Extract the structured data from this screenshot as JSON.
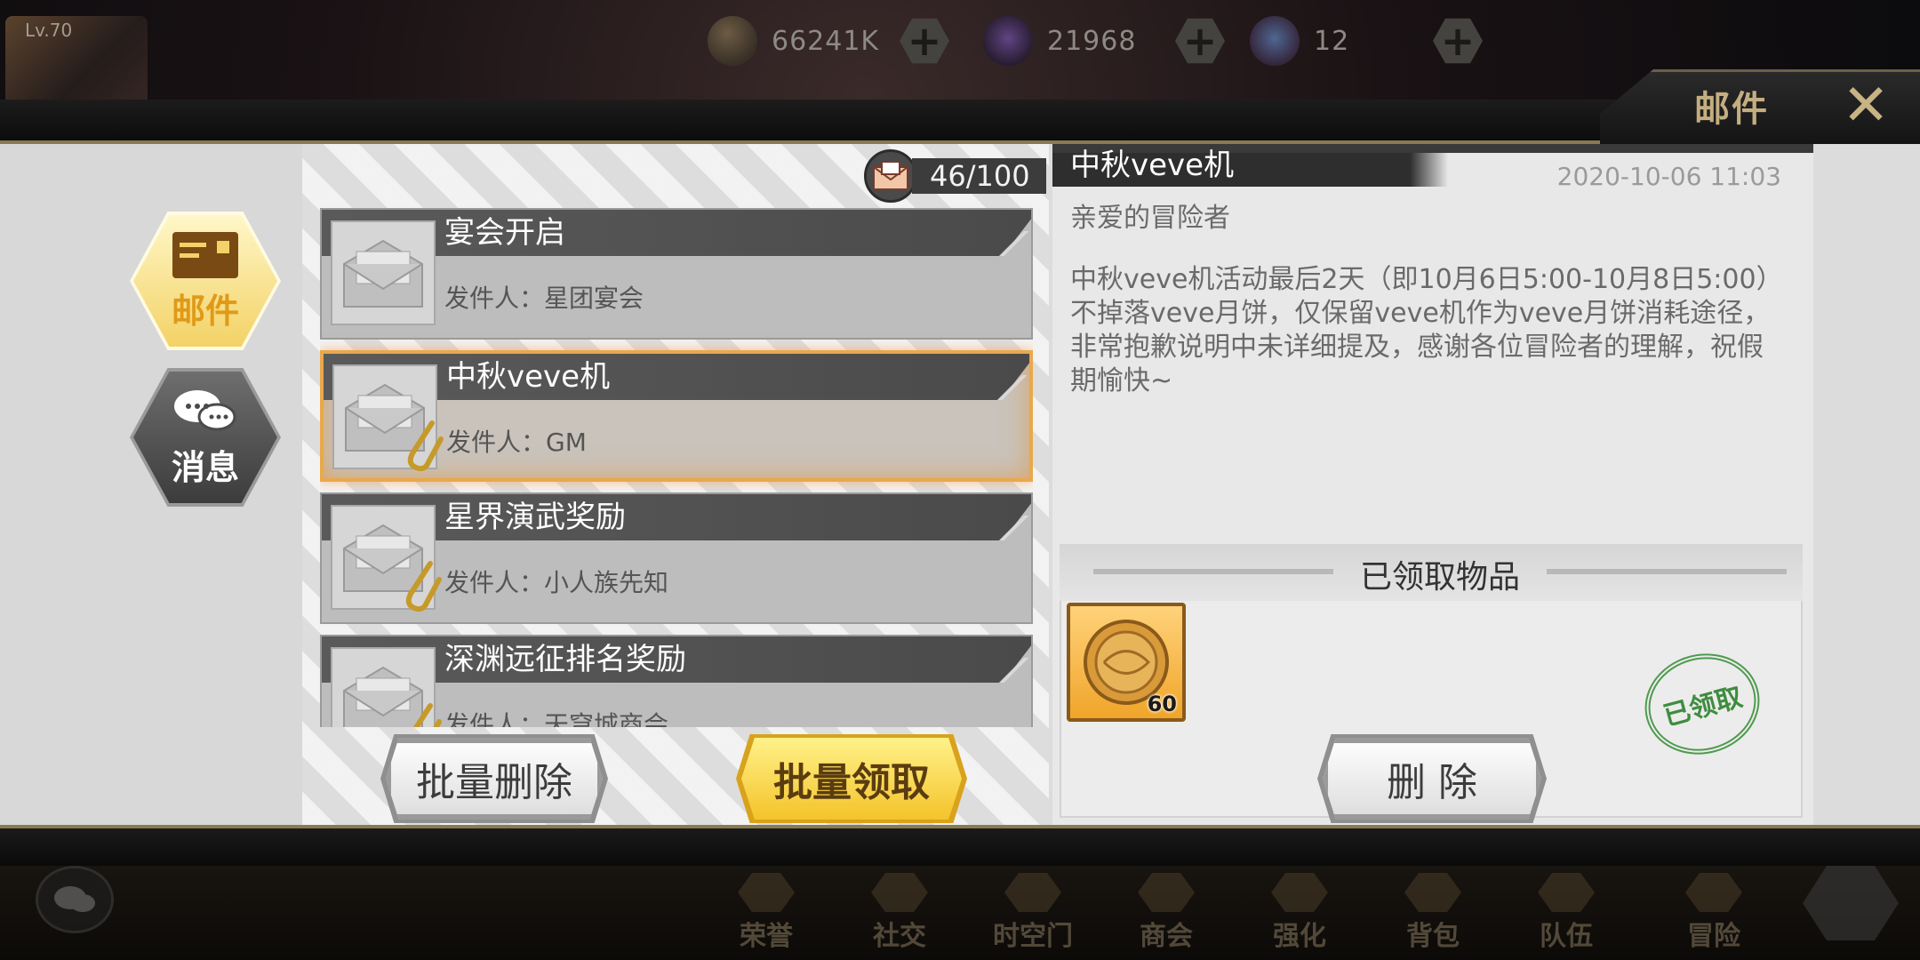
{
  "header": {
    "level": "Lv.70",
    "resources": [
      {
        "name": "gold-coin-icon",
        "value": "66241K"
      },
      {
        "name": "purple-gem-icon",
        "value": "21968"
      },
      {
        "name": "disk-token-icon",
        "value": "12"
      }
    ],
    "plus_symbol": "+",
    "title": "邮件",
    "close_symbol": "✕"
  },
  "side_tabs": {
    "mail_label": "邮件",
    "message_label": "消息"
  },
  "mailbox": {
    "count": "46/100",
    "items": [
      {
        "title": "宴会开启",
        "sender": "发件人：星团宴会",
        "has_attachment": false,
        "selected": false
      },
      {
        "title": "中秋veve机",
        "sender": "发件人：GM",
        "has_attachment": true,
        "selected": true
      },
      {
        "title": "星界演武奖励",
        "sender": "发件人：小人族先知",
        "has_attachment": true,
        "selected": false
      },
      {
        "title": "深渊远征排名奖励",
        "sender": "发件人：天穹城商会",
        "has_attachment": true,
        "selected": false
      }
    ],
    "batch_delete_label": "批量删除",
    "batch_claim_label": "批量领取"
  },
  "detail": {
    "title": "中秋veve机",
    "timestamp": "2020-10-06  11:03",
    "greeting": "亲爱的冒险者",
    "body": "中秋veve机活动最后2天（即10月6日5:00-10月8日5:00）不掉落veve月饼，仅保留veve机作为veve月饼消耗途径，非常抱歉说明中未详细提及，感谢各位冒险者的理解，祝假期愉快~",
    "rewards_title": "已领取物品",
    "reward_item": {
      "icon": "mooncake-icon",
      "quantity": "60"
    },
    "stamp_text": "已领取",
    "delete_label": "删 除"
  },
  "bottom_nav": [
    "荣誉",
    "社交",
    "时空门",
    "商会",
    "强化",
    "背包",
    "队伍",
    "冒险"
  ],
  "colors": {
    "accent_gold": "#f4c32a",
    "frame_line": "#8a7a52",
    "stamp_green": "#3f8c3f"
  }
}
